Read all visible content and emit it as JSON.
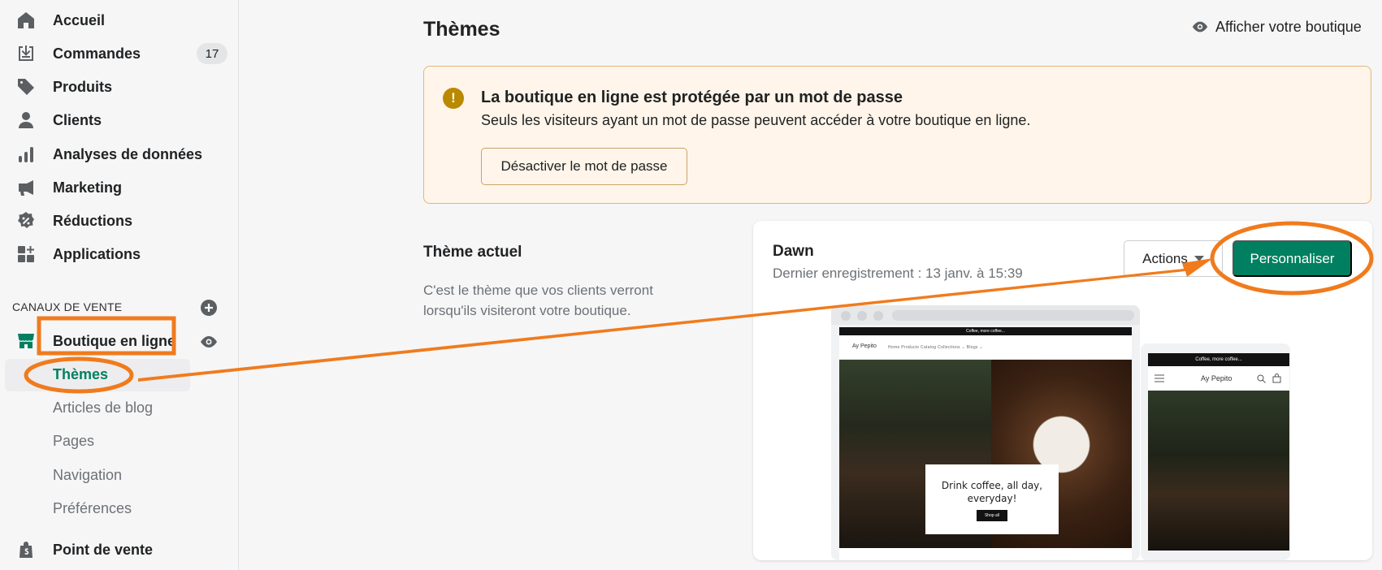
{
  "sidebar": {
    "items": [
      {
        "label": "Accueil",
        "icon": "home-icon"
      },
      {
        "label": "Commandes",
        "icon": "orders-icon",
        "badge": "17"
      },
      {
        "label": "Produits",
        "icon": "tag-icon"
      },
      {
        "label": "Clients",
        "icon": "person-icon"
      },
      {
        "label": "Analyses de données",
        "icon": "analytics-icon"
      },
      {
        "label": "Marketing",
        "icon": "megaphone-icon"
      },
      {
        "label": "Réductions",
        "icon": "discount-icon"
      },
      {
        "label": "Applications",
        "icon": "apps-icon"
      }
    ],
    "sales_channels_title": "CANAUX DE VENTE",
    "online_store": {
      "label": "Boutique en ligne",
      "subitems": [
        "Thèmes",
        "Articles de blog",
        "Pages",
        "Navigation",
        "Préférences"
      ],
      "active": "Thèmes"
    },
    "pos": {
      "label": "Point de vente"
    }
  },
  "header": {
    "title": "Thèmes",
    "view_store": "Afficher votre boutique"
  },
  "banner": {
    "title": "La boutique en ligne est protégée par un mot de passe",
    "text": "Seuls les visiteurs ayant un mot de passe peuvent accéder à votre boutique en ligne.",
    "button": "Désactiver le mot de passe"
  },
  "current_theme": {
    "heading": "Thème actuel",
    "description": "C'est le thème que vos clients verront lorsqu'ils visiteront votre boutique.",
    "name": "Dawn",
    "last_saved": "Dernier enregistrement : 13 janv. à 15:39",
    "actions_label": "Actions",
    "customize_label": "Personnaliser"
  },
  "preview": {
    "announcement": "Coffee, more coffee...",
    "logo": "Ay Pepito",
    "menu": "Home   Products   Catalog   Collections ⌄   Blogs ⌄",
    "hero_text": "Drink coffee, all day, everyday!",
    "hero_button": "Shop all"
  },
  "colors": {
    "accent": "#008060",
    "annotation": "#f07b1d",
    "warning": "#b98900"
  }
}
